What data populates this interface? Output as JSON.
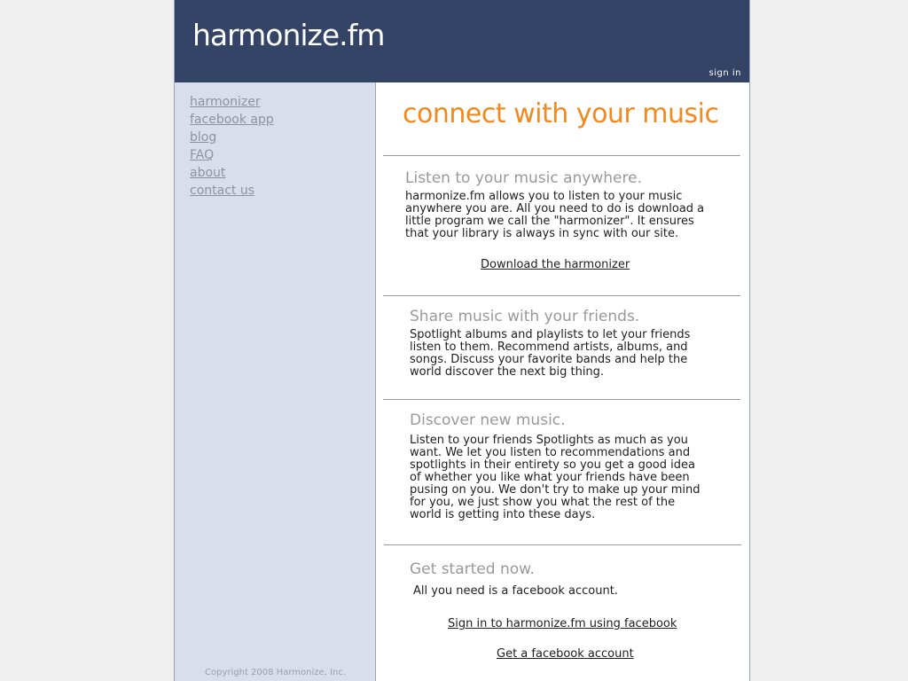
{
  "header": {
    "logo_main": "harmonize",
    "logo_suffix": ".fm",
    "sign_in": "sign in"
  },
  "sidebar": {
    "nav": [
      "harmonizer",
      "facebook app",
      "blog",
      "FAQ",
      "about",
      "contact us"
    ],
    "copyright": "Copyright 2008 Harmonize, Inc."
  },
  "main": {
    "tagline": "connect with your music",
    "sections": [
      {
        "title": "Listen to your music anywhere.",
        "lines": [
          "harmonize.fm allows you to listen to your music",
          "anywhere you are. All you need to do is download a",
          "little program we call the \"harmonizer\". It ensures",
          "that your library is always in sync with our site."
        ],
        "link": "Download the harmonizer"
      },
      {
        "title": "Share music with your friends.",
        "lines": [
          "Spotlight albums and playlists to let your friends",
          "listen to them. Recommend artists, albums, and",
          "songs. Discuss your favorite bands and help the",
          "world discover the next big thing."
        ]
      },
      {
        "title": "Discover new music.",
        "lines": [
          "Listen to your friends Spotlights as much as you",
          "want. We let you listen to recommendations and",
          "spotlights in their entirety so you get a good idea",
          "of whether you like what your friends have been",
          "pusing on you. We don't try to make up your mind",
          "for you, we just show you what the rest of the",
          "world is getting into these days."
        ]
      },
      {
        "title": "Get started now.",
        "lines": [
          "All you need is a facebook account."
        ],
        "links": [
          "Sign in to harmonize.fm using facebook",
          "Get a facebook account"
        ]
      }
    ]
  },
  "colors": {
    "header_bg": "#344467",
    "sidebar_bg": "#d9deed",
    "tagline": "#f2891f",
    "page_bg": "#efefef"
  }
}
